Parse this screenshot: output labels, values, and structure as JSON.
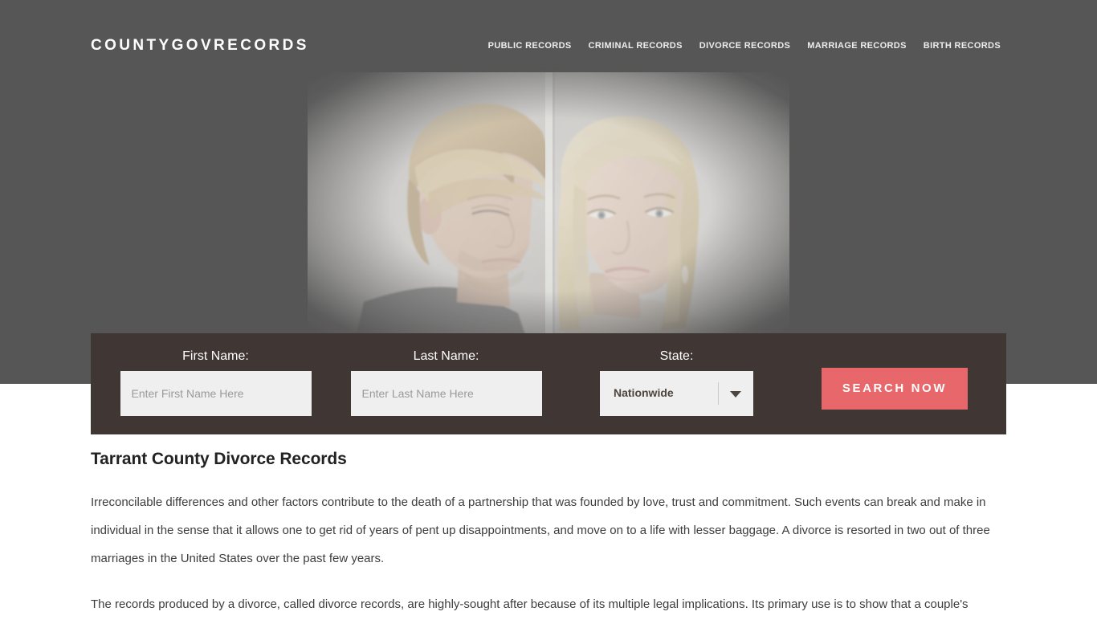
{
  "site": {
    "logo": "COUNTYGOVRECORDS"
  },
  "nav": {
    "items": [
      {
        "label": "PUBLIC RECORDS"
      },
      {
        "label": "CRIMINAL RECORDS"
      },
      {
        "label": "DIVORCE RECORDS"
      },
      {
        "label": "MARRIAGE RECORDS"
      },
      {
        "label": "BIRTH RECORDS"
      }
    ]
  },
  "hero": {
    "background_color": "#565656",
    "image_description": "Faded photograph of a man and a woman facing away from each other, split by a vertical white divider line"
  },
  "search_form": {
    "background_color": "#403734",
    "first_name": {
      "label": "First Name:",
      "placeholder": "Enter First Name Here",
      "value": ""
    },
    "last_name": {
      "label": "Last Name:",
      "placeholder": "Enter Last Name Here",
      "value": ""
    },
    "state": {
      "label": "State:",
      "selected": "Nationwide",
      "arrow_icon": "chevron-down-icon"
    },
    "submit": {
      "label": "SEARCH NOW",
      "color": "#e8676b"
    }
  },
  "article": {
    "title": "Tarrant County Divorce Records",
    "paragraphs": [
      "Irreconcilable differences and other factors contribute to the death of a partnership that was founded by love, trust and commitment. Such events can break and make in individual in the sense that it allows one to get rid of years of pent up disappointments, and move on to a life with lesser baggage. A divorce is resorted in two out of three marriages in the United States over the past few years.",
      "The records produced by a divorce, called divorce records, are highly-sought after because of its multiple legal implications. Its primary use is to show that a couple's"
    ]
  }
}
